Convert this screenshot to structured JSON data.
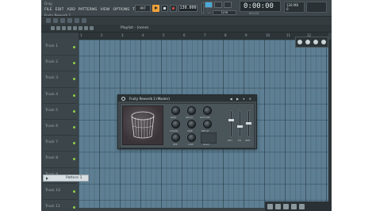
{
  "app": {
    "hint": "Drag",
    "subtitle": "Fruity Reeverb 2",
    "menu": [
      "FILE",
      "EDIT",
      "ADD",
      "PATTERNS",
      "VIEW",
      "OPTIONS",
      "TOOLS",
      "?"
    ],
    "pattern_button": "PAT",
    "tempo": "130.000",
    "time": "0:00:00",
    "time_unit": "M:S:CS",
    "snap_select": "Line",
    "cpu_lines": [
      "128 MB",
      "0"
    ]
  },
  "playlist": {
    "title": "Playlist - (none)",
    "ruler": [
      "1",
      "2",
      "3",
      "4",
      "5",
      "6",
      "7",
      "8",
      "9",
      "10",
      "11",
      "12"
    ],
    "tracks": [
      "Track 1",
      "Track 2",
      "Track 3",
      "Track 4",
      "Track 5",
      "Track 6",
      "Track 7",
      "Track 8",
      "Track 9",
      "Track 10",
      "Track 11"
    ],
    "pattern_box": "Pattern 1"
  },
  "plugin": {
    "title": "Fruity Reeverb 2 (Master)",
    "knob_labels": [
      "MOD",
      "DECAY",
      "DIFFUSE",
      "COLOR",
      "SIZE",
      "DELAY",
      "SEP",
      "LOW",
      "HIGH"
    ],
    "fader_labels": [
      "DRY",
      "ER",
      "WET"
    ]
  },
  "colors": {
    "accent": "#f0a23a",
    "grid": "#5e7f93",
    "snap_active": "#4aa9d8",
    "led": "#8cd14b"
  }
}
